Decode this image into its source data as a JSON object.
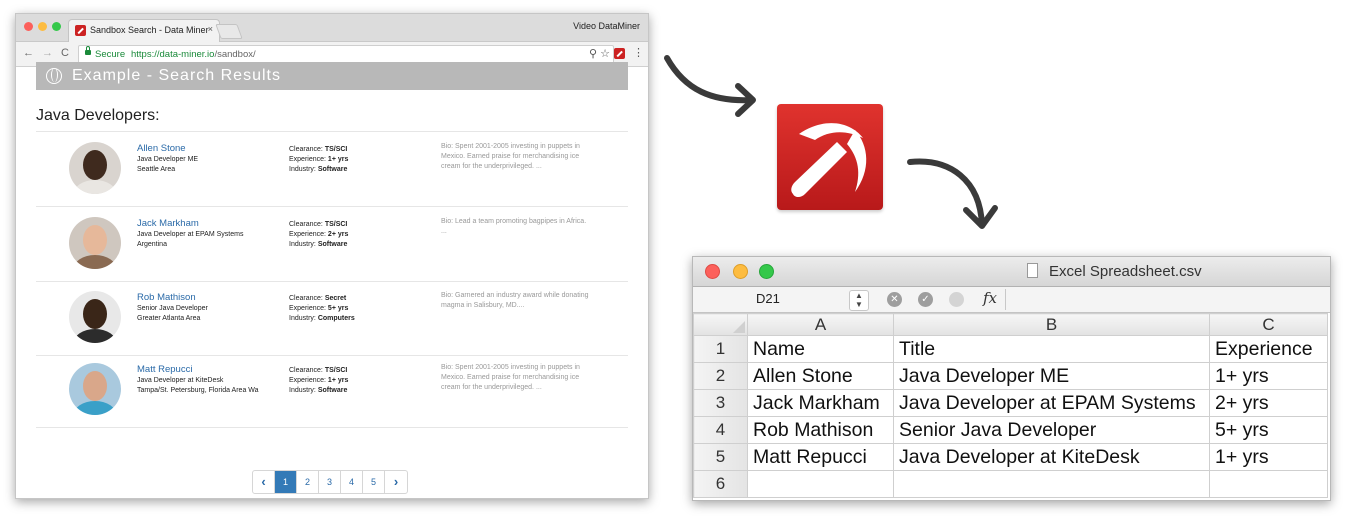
{
  "browser": {
    "tab_title": "Sandbox Search - Data Miner",
    "tab_close": "×",
    "profile_name": "Video DataMiner",
    "nav": {
      "back": "←",
      "forward": "→",
      "reload": "C"
    },
    "address": {
      "secure_label": "Secure",
      "url_scheme_host": "https://data-miner.io",
      "url_path": "/sandbox/"
    },
    "menu_icon": "⋮"
  },
  "page": {
    "banner_text": "Example - Search Results",
    "heading": "Java Developers:",
    "profiles": [
      {
        "name": "Allen Stone",
        "title": "Java Developer ME",
        "location": "Seattle Area",
        "clearance_label": "Clearance:",
        "clearance": "TS/SCI",
        "experience_label": "Experience:",
        "experience": "1+ yrs",
        "industry_label": "Industry:",
        "industry": "Software",
        "bio": "Bio: Spent 2001-2005 investing in puppets in Mexico. Earned praise for merchandising ice cream for the underprivileged. ..."
      },
      {
        "name": "Jack Markham",
        "title": "Java Developer at EPAM Systems",
        "location": "Argentina",
        "clearance_label": "Clearance:",
        "clearance": "TS/SCI",
        "experience_label": "Experience:",
        "experience": "2+ yrs",
        "industry_label": "Industry:",
        "industry": "Software",
        "bio": "Bio: Lead a team promoting bagpipes in Africa. ..."
      },
      {
        "name": "Rob Mathison",
        "title": "Senior Java Developer",
        "location": "Greater Atlanta Area",
        "clearance_label": "Clearance:",
        "clearance": "Secret",
        "experience_label": "Experience:",
        "experience": "5+ yrs",
        "industry_label": "Industry:",
        "industry": "Computers",
        "bio": "Bio: Garnered an industry award while donating magma in Salisbury, MD...."
      },
      {
        "name": "Matt Repucci",
        "title": "Java Developer at KiteDesk",
        "location": "Tampa/St. Petersburg, Florida Area Wa",
        "clearance_label": "Clearance:",
        "clearance": "TS/SCI",
        "experience_label": "Experience:",
        "experience": "1+ yrs",
        "industry_label": "Industry:",
        "industry": "Software",
        "bio": "Bio: Spent 2001-2005 investing in puppets in Mexico. Earned praise for merchandising ice cream for the underprivileged. ..."
      }
    ],
    "pagination": {
      "prev": "‹",
      "pages": [
        "1",
        "2",
        "3",
        "4",
        "5"
      ],
      "next": "›",
      "active_page": "1"
    }
  },
  "spreadsheet": {
    "window_title": "Excel Spreadsheet.csv",
    "name_box": "D21",
    "stepper": "▲▼",
    "cancel_glyph": "✕",
    "confirm_glyph": "✓",
    "fx_label": "fx",
    "column_headers": [
      "A",
      "B",
      "C"
    ],
    "row_headers": [
      "1",
      "2",
      "3",
      "4",
      "5",
      "6"
    ],
    "rows": [
      [
        "Name",
        "Title",
        "Experience"
      ],
      [
        "Allen Stone",
        "Java Developer ME",
        "1+ yrs"
      ],
      [
        "Jack Markham",
        "Java Developer at EPAM Systems",
        "2+ yrs"
      ],
      [
        "Rob Mathison",
        "Senior Java Developer",
        "5+ yrs"
      ],
      [
        "Matt Repucci",
        "Java Developer at KiteDesk",
        "1+ yrs"
      ],
      [
        "",
        "",
        ""
      ]
    ]
  },
  "icons": {
    "app_logo": "pickaxe-icon",
    "window_controls": [
      "close-dot",
      "minimize-dot",
      "zoom-dot"
    ]
  },
  "colors": {
    "logo_red": "#c9211f",
    "link_blue": "#2a6aa8",
    "secure_green": "#1a8a3a",
    "pager_active": "#337ab7",
    "mac_close": "#fc605b",
    "mac_min": "#fdbc40",
    "mac_zoom": "#34c84a"
  }
}
